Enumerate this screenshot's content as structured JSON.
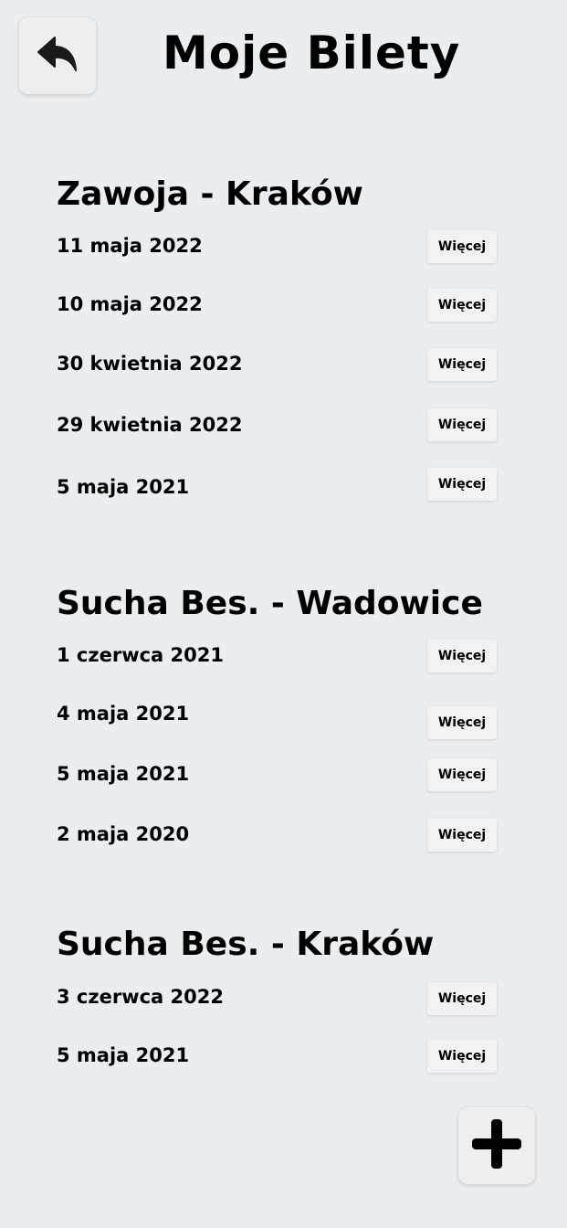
{
  "header": {
    "title": "Moje Bilety",
    "back_icon": "reply-arrow-icon"
  },
  "routes": [
    {
      "title": "Zawoja - Kraków",
      "tickets": [
        {
          "date": "11 maja 2022",
          "more_label": "Więcej"
        },
        {
          "date": "10 maja 2022",
          "more_label": "Więcej"
        },
        {
          "date": "30 kwietnia 2022",
          "more_label": "Więcej"
        },
        {
          "date": "29 kwietnia 2022",
          "more_label": "Więcej"
        },
        {
          "date": "5 maja 2021",
          "more_label": "Więcej"
        }
      ]
    },
    {
      "title": "Sucha Bes. - Wadowice",
      "tickets": [
        {
          "date": "1 czerwca 2021",
          "more_label": "Więcej"
        },
        {
          "date": "4 maja 2021",
          "more_label": "Więcej"
        },
        {
          "date": "5 maja 2021",
          "more_label": "Więcej"
        },
        {
          "date": "2 maja 2020",
          "more_label": "Więcej"
        }
      ]
    },
    {
      "title": "Sucha Bes. - Kraków",
      "tickets": [
        {
          "date": "3 czerwca 2022",
          "more_label": "Więcej"
        },
        {
          "date": "5 maja 2021",
          "more_label": "Więcej"
        }
      ]
    }
  ],
  "fab": {
    "icon": "plus-icon"
  }
}
